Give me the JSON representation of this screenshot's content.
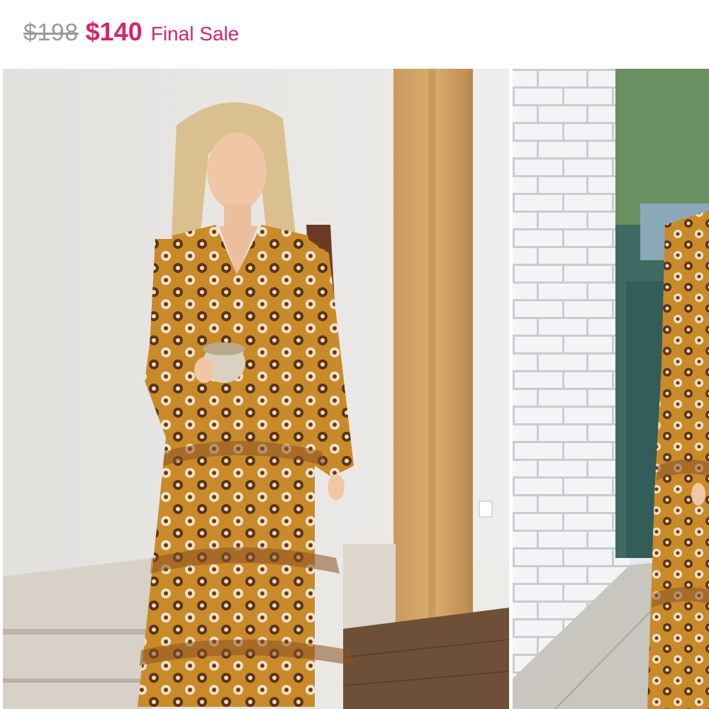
{
  "pricing": {
    "original_price": "$198",
    "sale_price": "$140",
    "sale_label": "Final Sale",
    "accent_color": "#d6246e",
    "muted_color": "#9a9a9a"
  },
  "gallery": {
    "images": [
      {
        "name": "product-photo-front"
      },
      {
        "name": "product-photo-side"
      }
    ]
  }
}
